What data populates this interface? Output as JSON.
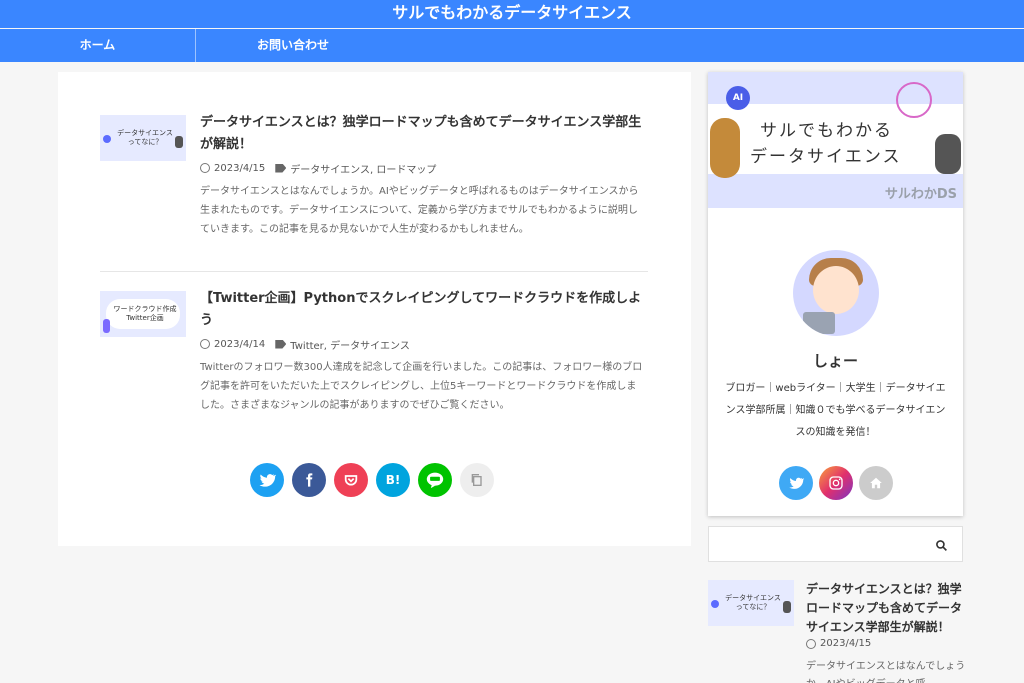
{
  "site": {
    "title": "サルでもわかるデータサイエンス"
  },
  "nav": {
    "items": [
      {
        "label": "ホーム"
      },
      {
        "label": "お問い合わせ"
      }
    ]
  },
  "posts": [
    {
      "title": "データサイエンスとは？独学ロードマップも含めてデータサイエンス学部生が解説！",
      "date": "2023/4/15",
      "tags": "データサイエンス, ロードマップ",
      "excerpt": "データサイエンスとはなんでしょうか。AIやビッグデータと呼ばれるものはデータサイエンスから生まれたものです。データサイエンスについて、定義から学び方までサルでもわかるように説明していきます。この記事を見るか見ないかで人生が変わるかもしれません。",
      "thumb_text": "データサイエンス\nってなに？"
    },
    {
      "title": "【Twitter企画】Pythonでスクレイピングしてワードクラウドを作成しよう",
      "date": "2023/4/14",
      "tags": "Twitter, データサイエンス",
      "excerpt": "Twitterのフォロワー数300人達成を記念して企画を行いました。この記事は、フォロワー様のブログ記事を許可をいただいた上でスクレイピングし、上位5キーワードとワードクラウドを作成しました。さまざまなジャンルの記事がありますのでぜひご覧ください。",
      "thumb_text": "ワードクラウド作成\nTwitter企画"
    }
  ],
  "share": {
    "hatena_label": "B!"
  },
  "profile": {
    "banner_title_1": "サルでもわかる",
    "banner_title_2": "データサイエンス",
    "banner_sub": "サルわかDS",
    "banner_ai": "AI",
    "name": "しょー",
    "bio": "ブロガー｜webライター｜大学生｜データサイエンス学部所属｜知識０でも学べるデータサイエンスの知識を発信！"
  },
  "search": {
    "value": "",
    "placeholder": ""
  },
  "sidebar_post": {
    "title": "データサイエンスとは？独学ロードマップも含めてデータサイエンス学部生が解説！",
    "date": "2023/4/15",
    "excerpt": "データサイエンスとはなんでしょうか。AIやビッグデータと呼",
    "thumb_text": "データサイエンス\nってなに？"
  },
  "colors": {
    "brand": "#3a86ff",
    "twitter": "#1da1f2",
    "facebook": "#3b5998",
    "pocket": "#ef4056",
    "hatena": "#00a4de",
    "line": "#00c300"
  }
}
